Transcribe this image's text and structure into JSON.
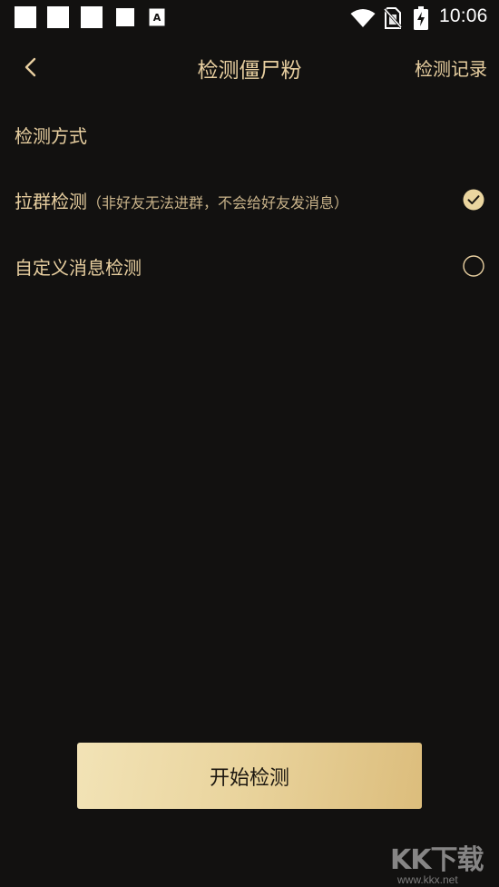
{
  "status_bar": {
    "time": "10:06",
    "notification_letter": "A"
  },
  "header": {
    "title": "检测僵尸粉",
    "records_label": "检测记录"
  },
  "section": {
    "title": "检测方式"
  },
  "options": [
    {
      "label": "拉群检测",
      "note": "（非好友无法进群，不会给好友发消息）",
      "selected": true
    },
    {
      "label": "自定义消息检测",
      "note": "",
      "selected": false
    }
  ],
  "start_button": {
    "label": "开始检测"
  },
  "watermark": {
    "logo": "KK下载",
    "url": "www.kkx.net"
  },
  "colors": {
    "background": "#121110",
    "accent_gold": "#e8cfa0",
    "button_gradient_start": "#f2e3b6",
    "button_gradient_end": "#dcbd7c",
    "check_fill": "#ead59f"
  },
  "icons": {
    "back": "chevron-left-icon",
    "wifi": "wifi-icon",
    "sim": "no-sim-icon",
    "battery": "battery-charging-icon",
    "selected_radio": "check-circle-icon",
    "unselected_radio": "empty-circle-icon"
  }
}
